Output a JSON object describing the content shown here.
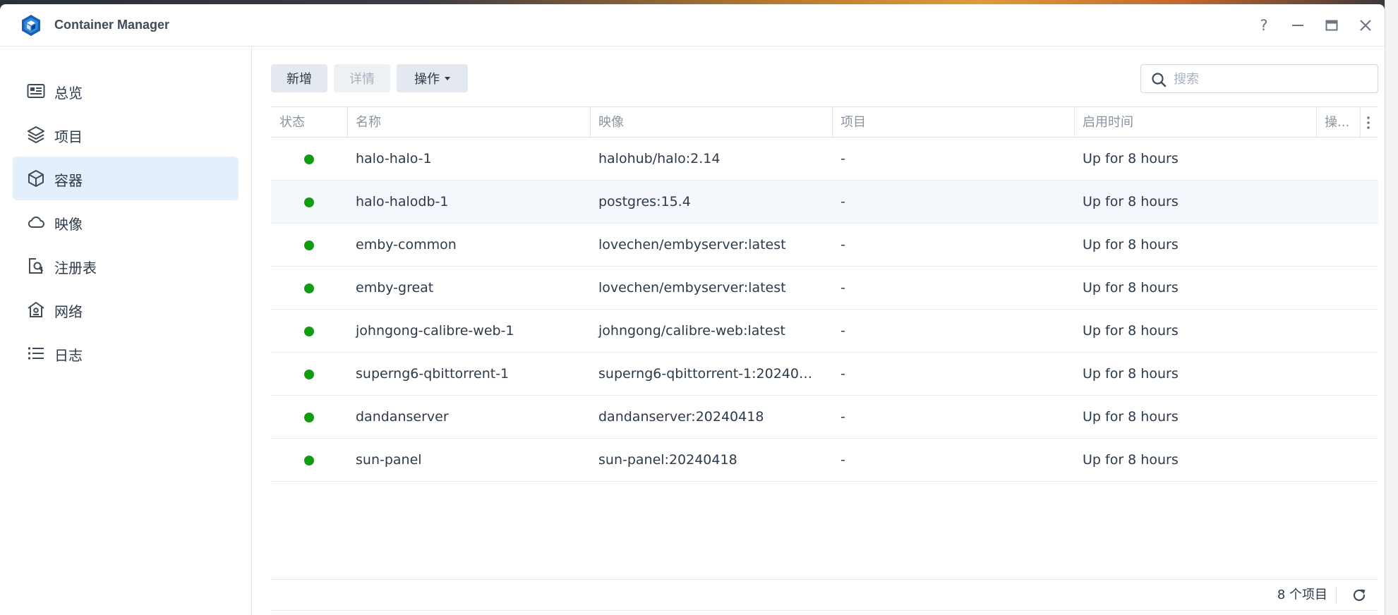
{
  "window": {
    "title": "Container Manager",
    "controls": {
      "help": "?"
    }
  },
  "sidebar": {
    "items": [
      {
        "label": "总览",
        "icon": "overview-icon",
        "active": false
      },
      {
        "label": "项目",
        "icon": "layers-icon",
        "active": false
      },
      {
        "label": "容器",
        "icon": "box-icon",
        "active": true
      },
      {
        "label": "映像",
        "icon": "cloud-icon",
        "active": false
      },
      {
        "label": "注册表",
        "icon": "registry-search-icon",
        "active": false
      },
      {
        "label": "网络",
        "icon": "network-home-icon",
        "active": false
      },
      {
        "label": "日志",
        "icon": "list-icon",
        "active": false
      }
    ]
  },
  "toolbar": {
    "add_label": "新增",
    "details_label": "详情",
    "actions_label": "操作",
    "search_placeholder": "搜索",
    "search_value": ""
  },
  "table": {
    "columns": [
      "状态",
      "名称",
      "映像",
      "项目",
      "启用时间",
      "操..."
    ],
    "rows": [
      {
        "status": "running",
        "name": "halo-halo-1",
        "image": "halohub/halo:2.14",
        "project": "-",
        "uptime": "Up for 8 hours"
      },
      {
        "status": "running",
        "name": "halo-halodb-1",
        "image": "postgres:15.4",
        "project": "-",
        "uptime": "Up for 8 hours"
      },
      {
        "status": "running",
        "name": "emby-common",
        "image": "lovechen/embyserver:latest",
        "project": "-",
        "uptime": "Up for 8 hours"
      },
      {
        "status": "running",
        "name": "emby-great",
        "image": "lovechen/embyserver:latest",
        "project": "-",
        "uptime": "Up for 8 hours"
      },
      {
        "status": "running",
        "name": "johngong-calibre-web-1",
        "image": "johngong/calibre-web:latest",
        "project": "-",
        "uptime": "Up for 8 hours"
      },
      {
        "status": "running",
        "name": "superng6-qbittorrent-1",
        "image": "superng6-qbittorrent-1:20240…",
        "project": "-",
        "uptime": "Up for 8 hours"
      },
      {
        "status": "running",
        "name": "dandanserver",
        "image": "dandanserver:20240418",
        "project": "-",
        "uptime": "Up for 8 hours"
      },
      {
        "status": "running",
        "name": "sun-panel",
        "image": "sun-panel:20240418",
        "project": "-",
        "uptime": "Up for 8 hours"
      }
    ]
  },
  "footer": {
    "count_label": "8 个项目"
  },
  "colors": {
    "accent": "#0e6ccd",
    "active_nav_bg": "#e4effc",
    "status_running": "#129c12"
  }
}
